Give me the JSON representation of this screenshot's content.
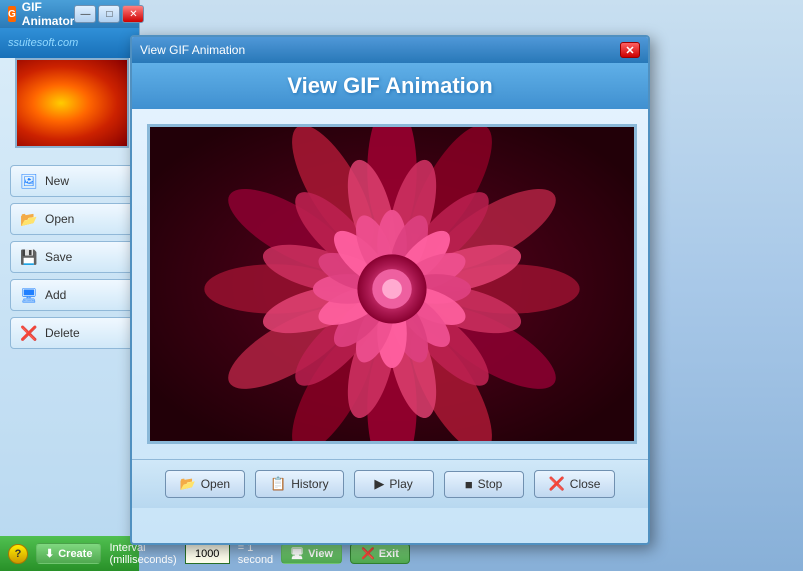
{
  "mainWindow": {
    "title": "GIF Animator",
    "brand": "ssuitesoft.com",
    "titleBarButtons": {
      "minimize": "—",
      "maximize": "□",
      "close": "✕"
    }
  },
  "sidebar": {
    "buttons": [
      {
        "id": "new",
        "label": "New",
        "icon": "🖼"
      },
      {
        "id": "open",
        "label": "Open",
        "icon": "📂"
      },
      {
        "id": "save",
        "label": "Save",
        "icon": "💾"
      },
      {
        "id": "add",
        "label": "Add",
        "icon": "🖥"
      },
      {
        "id": "delete",
        "label": "Delete",
        "icon": "❌"
      }
    ]
  },
  "bottomBar": {
    "help": "?",
    "create": "Create",
    "intervalLabel": "Interval (milliseconds)",
    "intervalValue": "1000",
    "equalsLabel": "= 1 second",
    "view": "View",
    "exit": "Exit"
  },
  "dialog": {
    "title": "View GIF Animation",
    "headerTitle": "View GIF Animation",
    "footerButtons": [
      {
        "id": "open",
        "label": "Open",
        "icon": "📂"
      },
      {
        "id": "history",
        "label": "History",
        "icon": "📋"
      },
      {
        "id": "play",
        "label": "Play",
        "icon": "▶"
      },
      {
        "id": "stop",
        "label": "Stop",
        "icon": "■"
      },
      {
        "id": "close",
        "label": "Close",
        "icon": "❌"
      }
    ]
  }
}
